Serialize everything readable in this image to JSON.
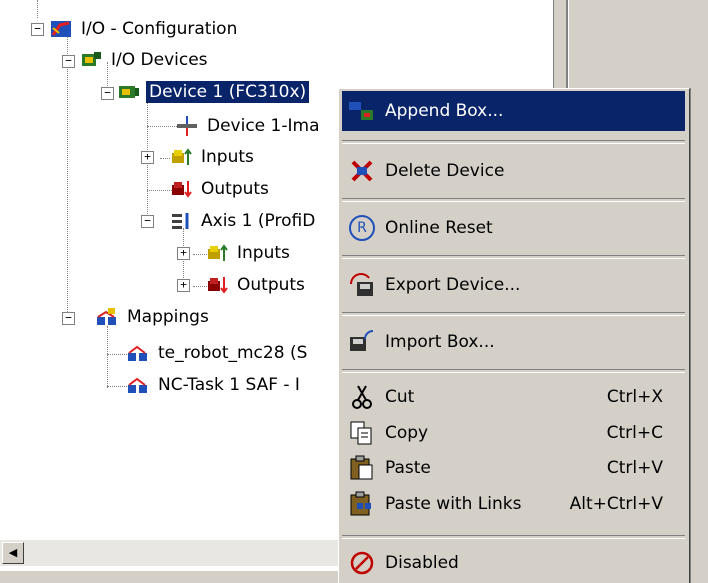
{
  "tree": {
    "root": "I/O - Configuration",
    "io_devices": "I/O Devices",
    "device1": "Device 1 (FC310x)",
    "device1_image": "Device 1-Ima",
    "inputs": "Inputs",
    "outputs": "Outputs",
    "axis1": "Axis 1 (ProfiD",
    "axis_inputs": "Inputs",
    "axis_outputs": "Outputs",
    "mappings": "Mappings",
    "mapping1": "te_robot_mc28 (S",
    "mapping2": "NC-Task 1 SAF - I",
    "expander_minus": "−",
    "expander_plus": "+"
  },
  "scroll": {
    "left_arrow": "◀"
  },
  "menu": {
    "items": [
      {
        "label": "Append Box...",
        "shortcut": "",
        "icon": "append-box-icon"
      },
      {
        "label": "Delete Device",
        "shortcut": "",
        "icon": "delete-icon"
      },
      {
        "label": "Online Reset",
        "shortcut": "",
        "icon": "reset-icon"
      },
      {
        "label": "Export Device...",
        "shortcut": "",
        "icon": "export-icon"
      },
      {
        "label": "Import Box...",
        "shortcut": "",
        "icon": "import-icon"
      },
      {
        "label": "Cut",
        "shortcut": "Ctrl+X",
        "icon": "scissors-icon"
      },
      {
        "label": "Copy",
        "shortcut": "Ctrl+C",
        "icon": "copy-icon"
      },
      {
        "label": "Paste",
        "shortcut": "Ctrl+V",
        "icon": "paste-icon"
      },
      {
        "label": "Paste with Links",
        "shortcut": "Alt+Ctrl+V",
        "icon": "paste-links-icon"
      },
      {
        "label": "Disabled",
        "shortcut": "",
        "icon": "disabled-icon"
      }
    ],
    "reset_glyph": "R"
  },
  "colors": {
    "selection": "#0a246a",
    "face": "#d4d0c8"
  }
}
